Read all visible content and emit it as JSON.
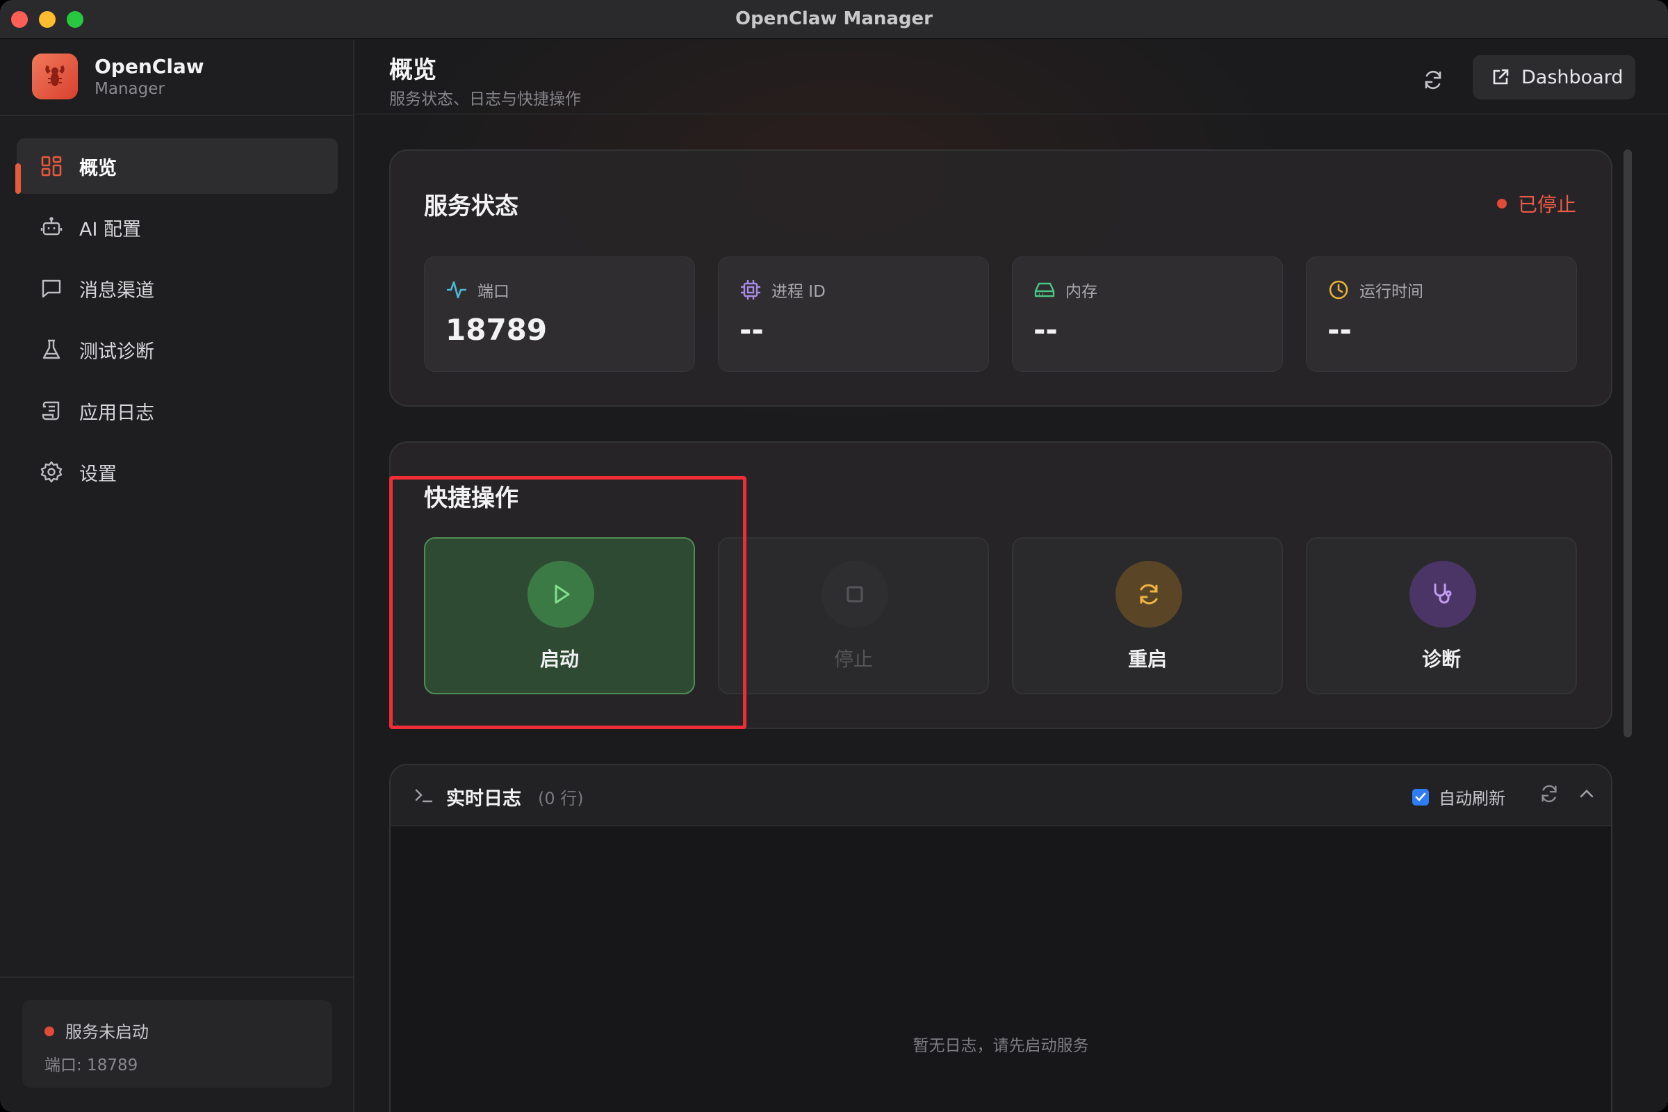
{
  "window": {
    "title": "OpenClaw Manager"
  },
  "brand": {
    "name": "OpenClaw",
    "subtitle": "Manager",
    "logo_icon": "lobster-icon"
  },
  "sidebar": {
    "items": [
      {
        "label": "概览",
        "icon": "grid-icon",
        "active": true
      },
      {
        "label": "AI 配置",
        "icon": "robot-icon",
        "active": false
      },
      {
        "label": "消息渠道",
        "icon": "message-icon",
        "active": false
      },
      {
        "label": "测试诊断",
        "icon": "flask-icon",
        "active": false
      },
      {
        "label": "应用日志",
        "icon": "scroll-icon",
        "active": false
      },
      {
        "label": "设置",
        "icon": "gear-icon",
        "active": false
      }
    ],
    "footer": {
      "status": "服务未启动",
      "port": "端口: 18789",
      "status_color": "#e24a3b"
    }
  },
  "header": {
    "title": "概览",
    "subtitle": "服务状态、日志与快捷操作",
    "dashboard_label": "Dashboard"
  },
  "service_status": {
    "title": "服务状态",
    "state": "已停止",
    "state_color": "#ec5a48",
    "stats": [
      {
        "label": "端口",
        "value": "18789",
        "icon": "activity-icon",
        "color": "#4fb8d8"
      },
      {
        "label": "进程 ID",
        "value": "--",
        "icon": "cpu-icon",
        "color": "#a98be8"
      },
      {
        "label": "内存",
        "value": "--",
        "icon": "drive-icon",
        "color": "#4cc486"
      },
      {
        "label": "运行时间",
        "value": "--",
        "icon": "clock-icon",
        "color": "#e7b43a"
      }
    ]
  },
  "quick_actions": {
    "title": "快捷操作",
    "items": [
      {
        "label": "启动",
        "icon": "play-icon",
        "enabled": true
      },
      {
        "label": "停止",
        "icon": "stop-icon",
        "enabled": false
      },
      {
        "label": "重启",
        "icon": "restart-icon",
        "enabled": true
      },
      {
        "label": "诊断",
        "icon": "stethoscope-icon",
        "enabled": true
      }
    ]
  },
  "logs": {
    "title": "实时日志",
    "count": "(0 行)",
    "auto_refresh_label": "自动刷新",
    "auto_refresh": true,
    "empty_text": "暂无日志，请先启动服务"
  },
  "colors": {
    "accent": "#e65b3c",
    "checkbox": "#2f7cf6",
    "start_green": "#4f8d55"
  }
}
